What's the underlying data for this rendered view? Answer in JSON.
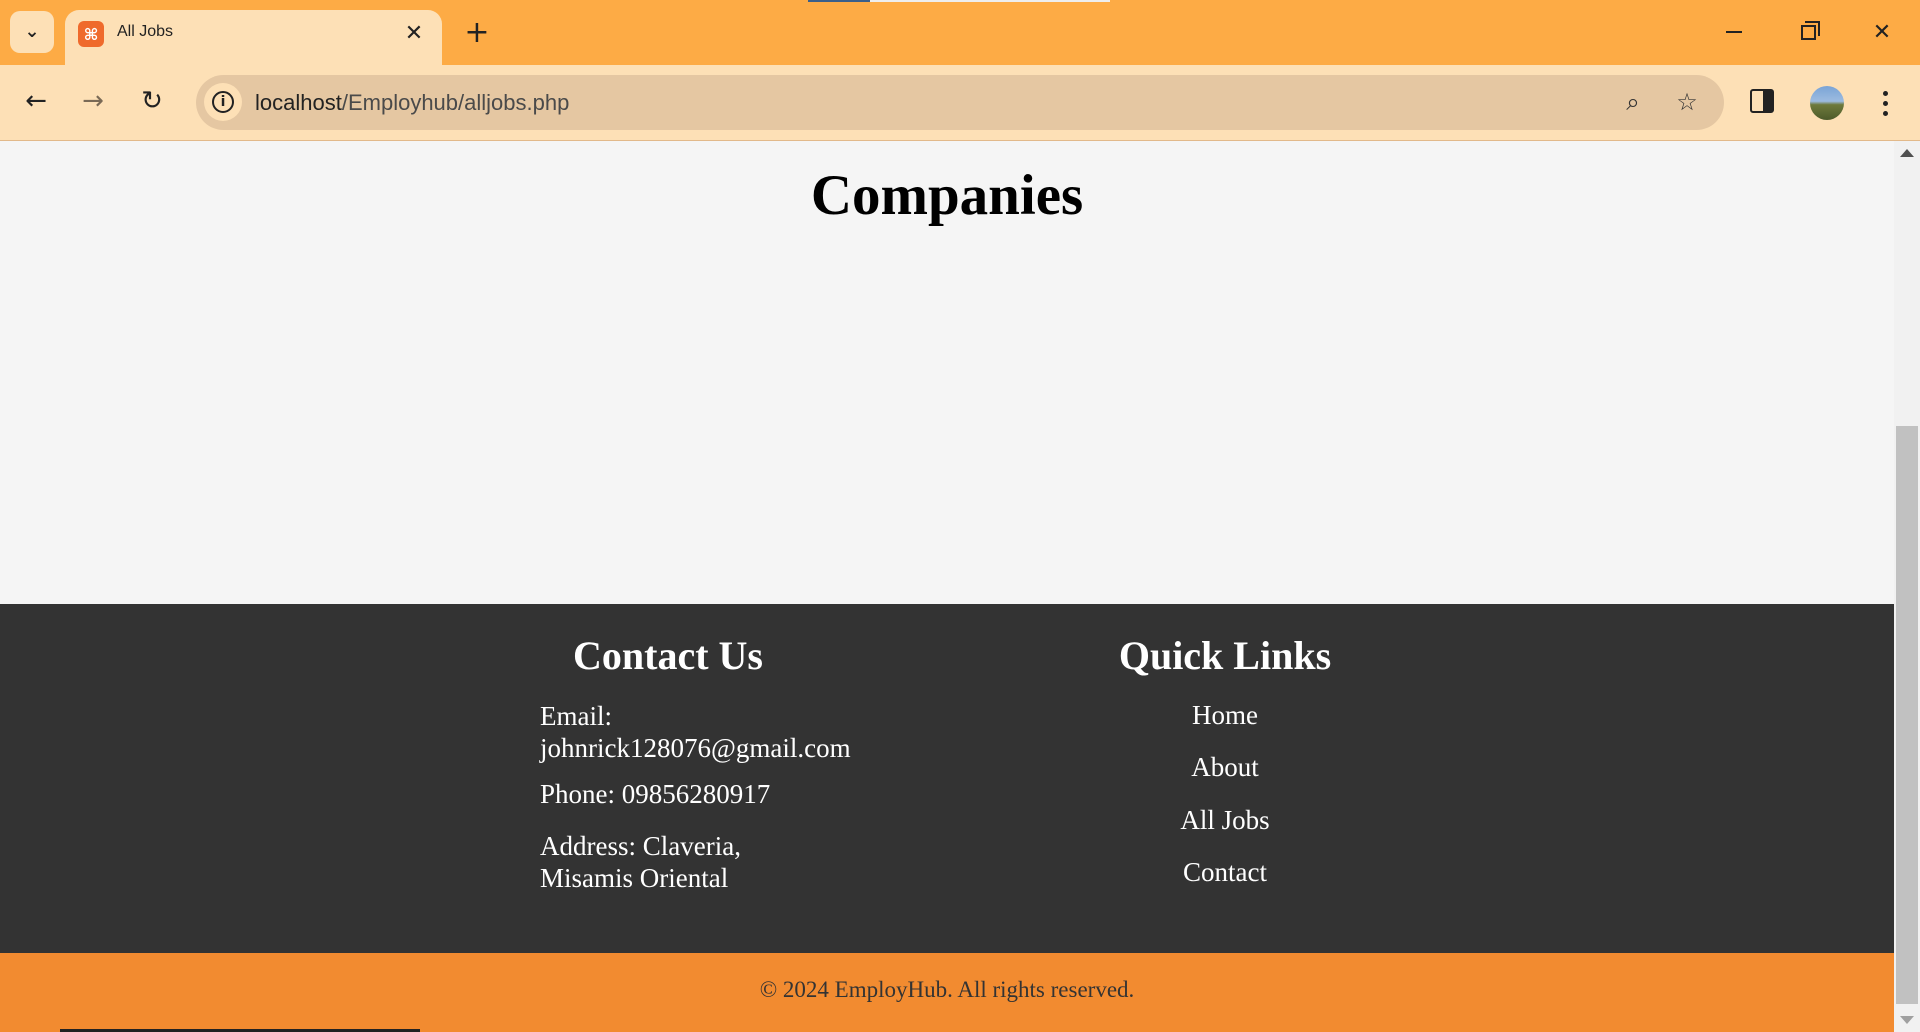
{
  "browser": {
    "tab_title": "All Jobs",
    "tab_favicon_glyph": "⌘",
    "close_tab_glyph": "✕",
    "new_tab_glyph": "+",
    "url_host": "localhost",
    "url_path": "/Employhub/alljobs.php",
    "info_glyph": "i",
    "zoom_glyph": "⌕",
    "star_glyph": "☆",
    "back_glyph": "←",
    "forward_glyph": "→",
    "reload_glyph": "↻",
    "close_window_glyph": "✕",
    "tab_search_glyph": "⌄"
  },
  "page": {
    "title": "Companies"
  },
  "footer": {
    "contact": {
      "heading": "Contact Us",
      "email": "Email: johnrick128076@gmail.com",
      "phone": "Phone: 09856280917",
      "address": "Address: Claveria, Misamis Oriental"
    },
    "quick_links": {
      "heading": "Quick Links",
      "links": [
        "Home",
        "About",
        "All Jobs",
        "Contact"
      ]
    },
    "copyright": "© 2024 EmployHub. All rights reserved."
  },
  "colors": {
    "tabbar": "#fdab45",
    "toolbar": "#fde0b6",
    "footer_bg": "#333333",
    "copyright_bg": "#f28b30"
  },
  "icons": [
    "tab-search-icon",
    "favicon-icon",
    "close-tab-icon",
    "new-tab-icon",
    "minimize-icon",
    "maximize-icon",
    "close-window-icon",
    "back-icon",
    "forward-icon",
    "reload-icon",
    "site-info-icon",
    "zoom-icon",
    "bookmark-star-icon",
    "side-panel-icon",
    "profile-avatar",
    "more-menu-icon"
  ]
}
